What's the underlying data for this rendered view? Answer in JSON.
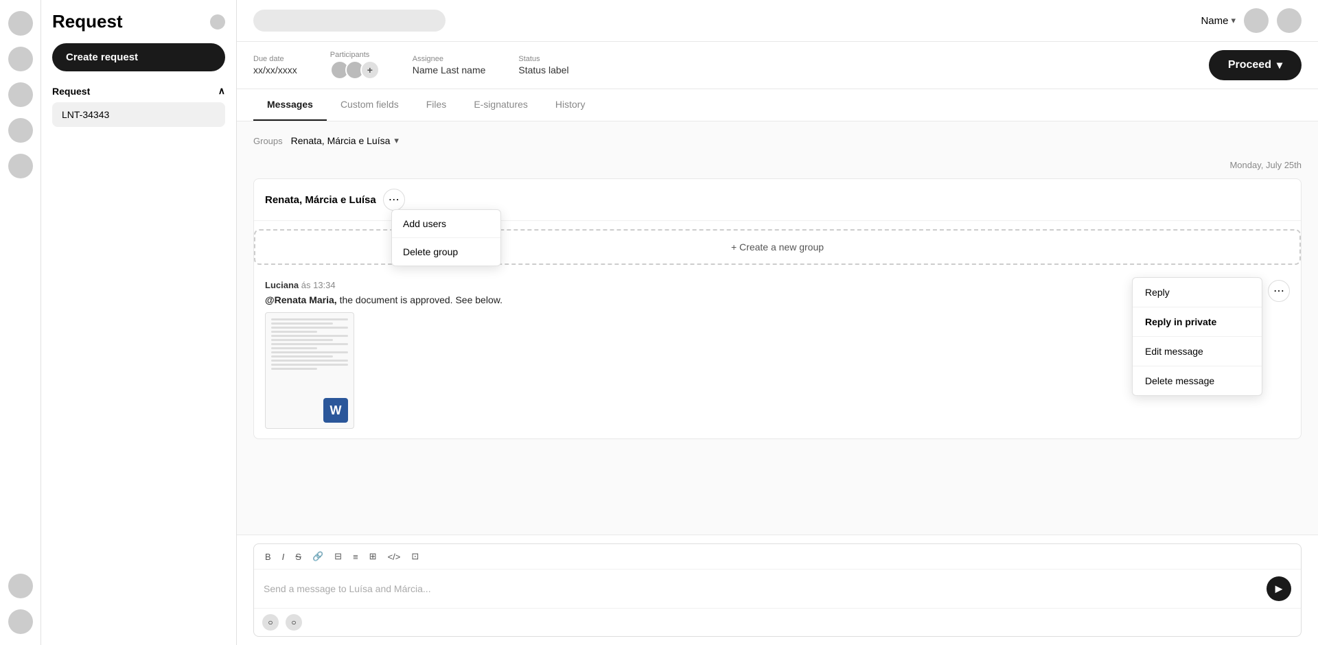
{
  "app": {
    "title": "Request"
  },
  "sidebar": {
    "title": "Request",
    "create_button_label": "Create request",
    "section_label": "Request",
    "active_item": "LNT-34343"
  },
  "header": {
    "search_placeholder": "",
    "name_label": "Name",
    "chevron": "▾"
  },
  "meta_bar": {
    "due_date_label": "Due date",
    "due_date_value": "xx/xx/xxxx",
    "participants_label": "Participants",
    "assignee_label": "Assignee",
    "assignee_value": "Name Last name",
    "status_label": "Status",
    "status_value": "Status label",
    "proceed_label": "Proceed",
    "proceed_chevron": "▾"
  },
  "tabs": {
    "items": [
      {
        "label": "Messages",
        "active": true
      },
      {
        "label": "Custom fields",
        "active": false
      },
      {
        "label": "Files",
        "active": false
      },
      {
        "label": "E-signatures",
        "active": false
      },
      {
        "label": "History",
        "active": false
      }
    ]
  },
  "messages": {
    "groups_label": "Groups",
    "selected_group": "Renata, Márcia e Luísa",
    "date_divider": "Monday, July 25th",
    "group_name": "Renata, Márcia e Luísa",
    "group_menu": {
      "add_users": "Add users",
      "delete_group": "Delete group"
    },
    "create_group_label": "+ Create a new group",
    "message": {
      "author": "Luciana",
      "time": "ás 13:34",
      "mention": "@Renata Maria,",
      "body": " the document is approved. See below."
    },
    "message_menu": {
      "reply": "Reply",
      "reply_private": "Reply in private",
      "edit": "Edit message",
      "delete": "Delete message"
    },
    "input_placeholder": "Send a message to Luísa and Márcia...",
    "toolbar": {
      "bold": "B",
      "italic": "I",
      "strikethrough": "S",
      "link": "🔗",
      "ordered_list": "≡",
      "unordered_list": "≡",
      "indent": "≡",
      "code": "</>",
      "table": "⊞"
    }
  }
}
